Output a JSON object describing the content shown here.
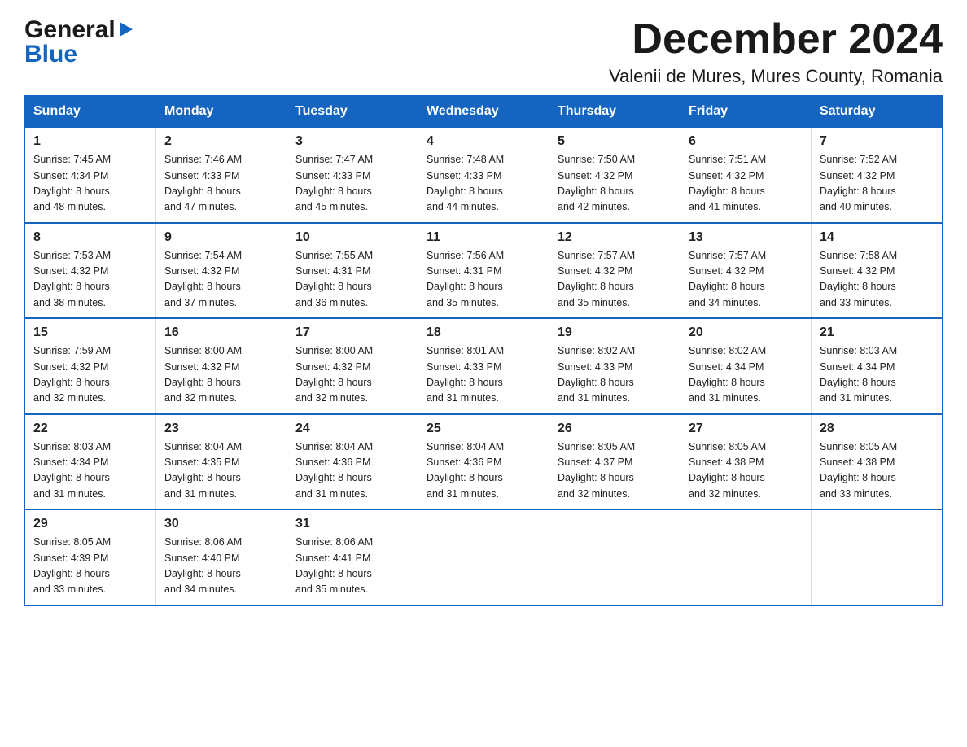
{
  "logo": {
    "general": "General",
    "blue": "Blue",
    "arrow": "▶"
  },
  "title": "December 2024",
  "subtitle": "Valenii de Mures, Mures County, Romania",
  "days": [
    "Sunday",
    "Monday",
    "Tuesday",
    "Wednesday",
    "Thursday",
    "Friday",
    "Saturday"
  ],
  "weeks": [
    [
      {
        "day": 1,
        "sunrise": "7:45 AM",
        "sunset": "4:34 PM",
        "daylight": "8 hours and 48 minutes."
      },
      {
        "day": 2,
        "sunrise": "7:46 AM",
        "sunset": "4:33 PM",
        "daylight": "8 hours and 47 minutes."
      },
      {
        "day": 3,
        "sunrise": "7:47 AM",
        "sunset": "4:33 PM",
        "daylight": "8 hours and 45 minutes."
      },
      {
        "day": 4,
        "sunrise": "7:48 AM",
        "sunset": "4:33 PM",
        "daylight": "8 hours and 44 minutes."
      },
      {
        "day": 5,
        "sunrise": "7:50 AM",
        "sunset": "4:32 PM",
        "daylight": "8 hours and 42 minutes."
      },
      {
        "day": 6,
        "sunrise": "7:51 AM",
        "sunset": "4:32 PM",
        "daylight": "8 hours and 41 minutes."
      },
      {
        "day": 7,
        "sunrise": "7:52 AM",
        "sunset": "4:32 PM",
        "daylight": "8 hours and 40 minutes."
      }
    ],
    [
      {
        "day": 8,
        "sunrise": "7:53 AM",
        "sunset": "4:32 PM",
        "daylight": "8 hours and 38 minutes."
      },
      {
        "day": 9,
        "sunrise": "7:54 AM",
        "sunset": "4:32 PM",
        "daylight": "8 hours and 37 minutes."
      },
      {
        "day": 10,
        "sunrise": "7:55 AM",
        "sunset": "4:31 PM",
        "daylight": "8 hours and 36 minutes."
      },
      {
        "day": 11,
        "sunrise": "7:56 AM",
        "sunset": "4:31 PM",
        "daylight": "8 hours and 35 minutes."
      },
      {
        "day": 12,
        "sunrise": "7:57 AM",
        "sunset": "4:32 PM",
        "daylight": "8 hours and 35 minutes."
      },
      {
        "day": 13,
        "sunrise": "7:57 AM",
        "sunset": "4:32 PM",
        "daylight": "8 hours and 34 minutes."
      },
      {
        "day": 14,
        "sunrise": "7:58 AM",
        "sunset": "4:32 PM",
        "daylight": "8 hours and 33 minutes."
      }
    ],
    [
      {
        "day": 15,
        "sunrise": "7:59 AM",
        "sunset": "4:32 PM",
        "daylight": "8 hours and 32 minutes."
      },
      {
        "day": 16,
        "sunrise": "8:00 AM",
        "sunset": "4:32 PM",
        "daylight": "8 hours and 32 minutes."
      },
      {
        "day": 17,
        "sunrise": "8:00 AM",
        "sunset": "4:32 PM",
        "daylight": "8 hours and 32 minutes."
      },
      {
        "day": 18,
        "sunrise": "8:01 AM",
        "sunset": "4:33 PM",
        "daylight": "8 hours and 31 minutes."
      },
      {
        "day": 19,
        "sunrise": "8:02 AM",
        "sunset": "4:33 PM",
        "daylight": "8 hours and 31 minutes."
      },
      {
        "day": 20,
        "sunrise": "8:02 AM",
        "sunset": "4:34 PM",
        "daylight": "8 hours and 31 minutes."
      },
      {
        "day": 21,
        "sunrise": "8:03 AM",
        "sunset": "4:34 PM",
        "daylight": "8 hours and 31 minutes."
      }
    ],
    [
      {
        "day": 22,
        "sunrise": "8:03 AM",
        "sunset": "4:34 PM",
        "daylight": "8 hours and 31 minutes."
      },
      {
        "day": 23,
        "sunrise": "8:04 AM",
        "sunset": "4:35 PM",
        "daylight": "8 hours and 31 minutes."
      },
      {
        "day": 24,
        "sunrise": "8:04 AM",
        "sunset": "4:36 PM",
        "daylight": "8 hours and 31 minutes."
      },
      {
        "day": 25,
        "sunrise": "8:04 AM",
        "sunset": "4:36 PM",
        "daylight": "8 hours and 31 minutes."
      },
      {
        "day": 26,
        "sunrise": "8:05 AM",
        "sunset": "4:37 PM",
        "daylight": "8 hours and 32 minutes."
      },
      {
        "day": 27,
        "sunrise": "8:05 AM",
        "sunset": "4:38 PM",
        "daylight": "8 hours and 32 minutes."
      },
      {
        "day": 28,
        "sunrise": "8:05 AM",
        "sunset": "4:38 PM",
        "daylight": "8 hours and 33 minutes."
      }
    ],
    [
      {
        "day": 29,
        "sunrise": "8:05 AM",
        "sunset": "4:39 PM",
        "daylight": "8 hours and 33 minutes."
      },
      {
        "day": 30,
        "sunrise": "8:06 AM",
        "sunset": "4:40 PM",
        "daylight": "8 hours and 34 minutes."
      },
      {
        "day": 31,
        "sunrise": "8:06 AM",
        "sunset": "4:41 PM",
        "daylight": "8 hours and 35 minutes."
      },
      null,
      null,
      null,
      null
    ]
  ],
  "labels": {
    "sunrise": "Sunrise:",
    "sunset": "Sunset:",
    "daylight": "Daylight:"
  }
}
